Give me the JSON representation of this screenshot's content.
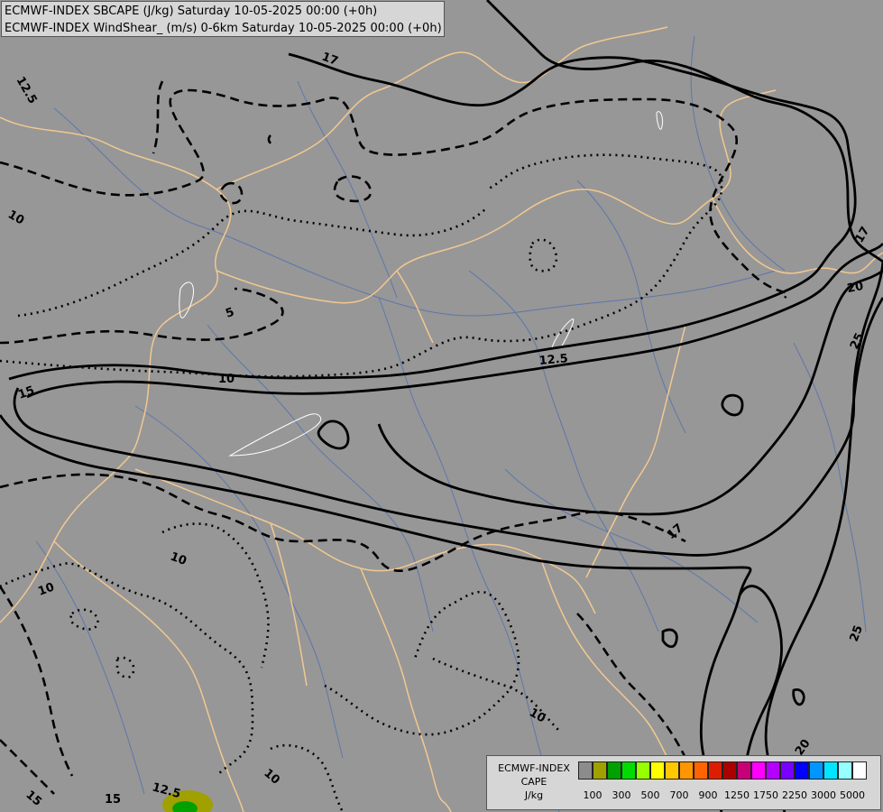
{
  "header": {
    "line1": "ECMWF-INDEX SBCAPE (J/kg) Saturday 10-05-2025 00:00 (+0h)",
    "line2": "ECMWF-INDEX WindShear_ (m/s) 0-6km Saturday 10-05-2025 00:00 (+0h)"
  },
  "legend": {
    "title1": "ECMWF-INDEX",
    "title2": "CAPE",
    "unit": "J/kg",
    "colors": [
      "#8c8c8c",
      "#a0a000",
      "#00a000",
      "#00dc00",
      "#96ff00",
      "#ffff00",
      "#ffc800",
      "#ff9600",
      "#ff6400",
      "#dc1e00",
      "#aa0000",
      "#c80078",
      "#ff00ff",
      "#b400ff",
      "#7800ff",
      "#0000ff",
      "#0096ff",
      "#00e6ff",
      "#96ffff",
      "#ffffff"
    ],
    "tick_labels": [
      "100",
      "300",
      "500",
      "700",
      "900",
      "1250",
      "1750",
      "2250",
      "3000",
      "5000"
    ]
  },
  "contour_labels": {
    "l_12_5_nw": "12.5",
    "l_10_w": "10",
    "l_5": "5",
    "l_17_n": "17",
    "l_15_w": "15",
    "l_10_c": "10",
    "l_12_5_c": "12.5",
    "l_20_e": "20",
    "l_17_e": "17",
    "l_25_e": "25",
    "l_17_ne": "17",
    "l_10_sw": "10",
    "l_10_sw2": "10",
    "l_25_se": "25",
    "l_10_s": "10",
    "l_10_s2": "10",
    "l_20_se": "20",
    "l_12_5_s": "12.5",
    "l_15_s": "15",
    "l_15_sw": "15"
  }
}
